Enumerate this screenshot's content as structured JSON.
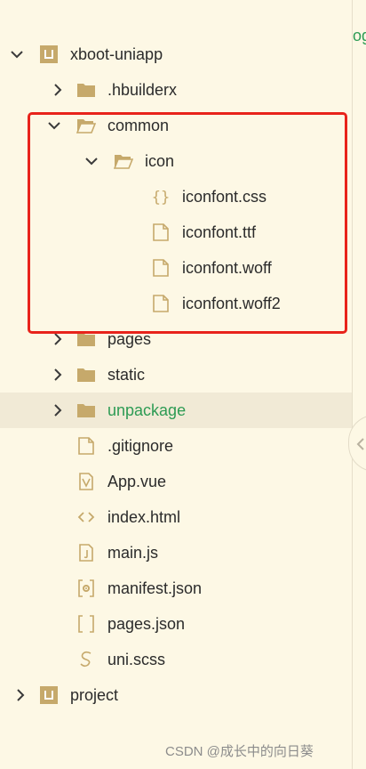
{
  "editor_peek": "og",
  "tree": {
    "root": {
      "label": "xboot-uniapp",
      "icon": "project-icon",
      "expanded": true
    },
    "hbuilderx": {
      "label": ".hbuilderx",
      "icon": "folder-icon",
      "expanded": false
    },
    "common": {
      "label": "common",
      "icon": "folder-open-icon",
      "expanded": true
    },
    "icon_folder": {
      "label": "icon",
      "icon": "folder-open-icon",
      "expanded": true
    },
    "iconfont_css": {
      "label": "iconfont.css",
      "icon": "css-file-icon"
    },
    "iconfont_ttf": {
      "label": "iconfont.ttf",
      "icon": "file-icon"
    },
    "iconfont_woff": {
      "label": "iconfont.woff",
      "icon": "file-icon"
    },
    "iconfont_woff2": {
      "label": "iconfont.woff2",
      "icon": "file-icon"
    },
    "pages": {
      "label": "pages",
      "icon": "folder-icon",
      "expanded": false
    },
    "static": {
      "label": "static",
      "icon": "folder-icon",
      "expanded": false
    },
    "unpackage": {
      "label": "unpackage",
      "icon": "folder-icon",
      "expanded": false,
      "selected": true
    },
    "gitignore": {
      "label": ".gitignore",
      "icon": "file-icon"
    },
    "app_vue": {
      "label": "App.vue",
      "icon": "vue-file-icon"
    },
    "index_html": {
      "label": "index.html",
      "icon": "html-file-icon"
    },
    "main_js": {
      "label": "main.js",
      "icon": "js-file-icon"
    },
    "manifest_json": {
      "label": "manifest.json",
      "icon": "manifest-file-icon"
    },
    "pages_json": {
      "label": "pages.json",
      "icon": "json-file-icon"
    },
    "uni_scss": {
      "label": "uni.scss",
      "icon": "scss-file-icon"
    },
    "project": {
      "label": "project",
      "icon": "project-icon",
      "expanded": false
    }
  },
  "watermark": "CSDN @成长中的向日葵",
  "colors": {
    "background": "#fdf8e5",
    "selected_row": "#f1ead6",
    "folder": "#c6a96b",
    "green_text": "#2d9b54",
    "highlight_box": "#e8231b"
  }
}
